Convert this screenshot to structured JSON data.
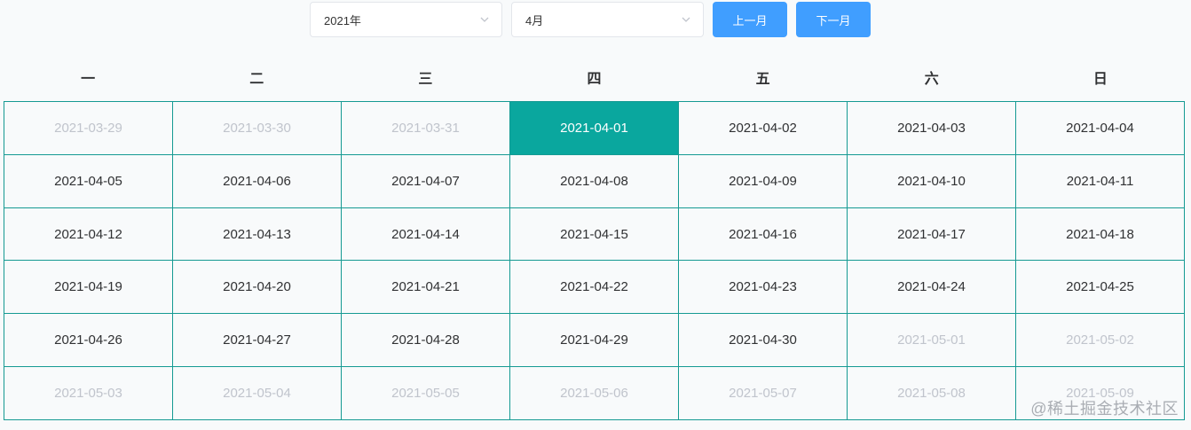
{
  "toolbar": {
    "year_value": "2021年",
    "month_value": "4月",
    "prev_label": "上一月",
    "next_label": "下一月"
  },
  "weekdays": [
    "一",
    "二",
    "三",
    "四",
    "五",
    "六",
    "日"
  ],
  "days": [
    {
      "label": "2021-03-29",
      "current": false,
      "selected": false
    },
    {
      "label": "2021-03-30",
      "current": false,
      "selected": false
    },
    {
      "label": "2021-03-31",
      "current": false,
      "selected": false
    },
    {
      "label": "2021-04-01",
      "current": true,
      "selected": true
    },
    {
      "label": "2021-04-02",
      "current": true,
      "selected": false
    },
    {
      "label": "2021-04-03",
      "current": true,
      "selected": false
    },
    {
      "label": "2021-04-04",
      "current": true,
      "selected": false
    },
    {
      "label": "2021-04-05",
      "current": true,
      "selected": false
    },
    {
      "label": "2021-04-06",
      "current": true,
      "selected": false
    },
    {
      "label": "2021-04-07",
      "current": true,
      "selected": false
    },
    {
      "label": "2021-04-08",
      "current": true,
      "selected": false
    },
    {
      "label": "2021-04-09",
      "current": true,
      "selected": false
    },
    {
      "label": "2021-04-10",
      "current": true,
      "selected": false
    },
    {
      "label": "2021-04-11",
      "current": true,
      "selected": false
    },
    {
      "label": "2021-04-12",
      "current": true,
      "selected": false
    },
    {
      "label": "2021-04-13",
      "current": true,
      "selected": false
    },
    {
      "label": "2021-04-14",
      "current": true,
      "selected": false
    },
    {
      "label": "2021-04-15",
      "current": true,
      "selected": false
    },
    {
      "label": "2021-04-16",
      "current": true,
      "selected": false
    },
    {
      "label": "2021-04-17",
      "current": true,
      "selected": false
    },
    {
      "label": "2021-04-18",
      "current": true,
      "selected": false
    },
    {
      "label": "2021-04-19",
      "current": true,
      "selected": false
    },
    {
      "label": "2021-04-20",
      "current": true,
      "selected": false
    },
    {
      "label": "2021-04-21",
      "current": true,
      "selected": false
    },
    {
      "label": "2021-04-22",
      "current": true,
      "selected": false
    },
    {
      "label": "2021-04-23",
      "current": true,
      "selected": false
    },
    {
      "label": "2021-04-24",
      "current": true,
      "selected": false
    },
    {
      "label": "2021-04-25",
      "current": true,
      "selected": false
    },
    {
      "label": "2021-04-26",
      "current": true,
      "selected": false
    },
    {
      "label": "2021-04-27",
      "current": true,
      "selected": false
    },
    {
      "label": "2021-04-28",
      "current": true,
      "selected": false
    },
    {
      "label": "2021-04-29",
      "current": true,
      "selected": false
    },
    {
      "label": "2021-04-30",
      "current": true,
      "selected": false
    },
    {
      "label": "2021-05-01",
      "current": false,
      "selected": false
    },
    {
      "label": "2021-05-02",
      "current": false,
      "selected": false
    },
    {
      "label": "2021-05-03",
      "current": false,
      "selected": false
    },
    {
      "label": "2021-05-04",
      "current": false,
      "selected": false
    },
    {
      "label": "2021-05-05",
      "current": false,
      "selected": false
    },
    {
      "label": "2021-05-06",
      "current": false,
      "selected": false
    },
    {
      "label": "2021-05-07",
      "current": false,
      "selected": false
    },
    {
      "label": "2021-05-08",
      "current": false,
      "selected": false
    },
    {
      "label": "2021-05-09",
      "current": false,
      "selected": false
    }
  ],
  "colors": {
    "accent_button": "#409eff",
    "selected_cell": "#0aa79e",
    "grid_border": "#159a93",
    "muted_text": "#c0c4cc"
  },
  "watermark": "@稀土掘金技术社区"
}
